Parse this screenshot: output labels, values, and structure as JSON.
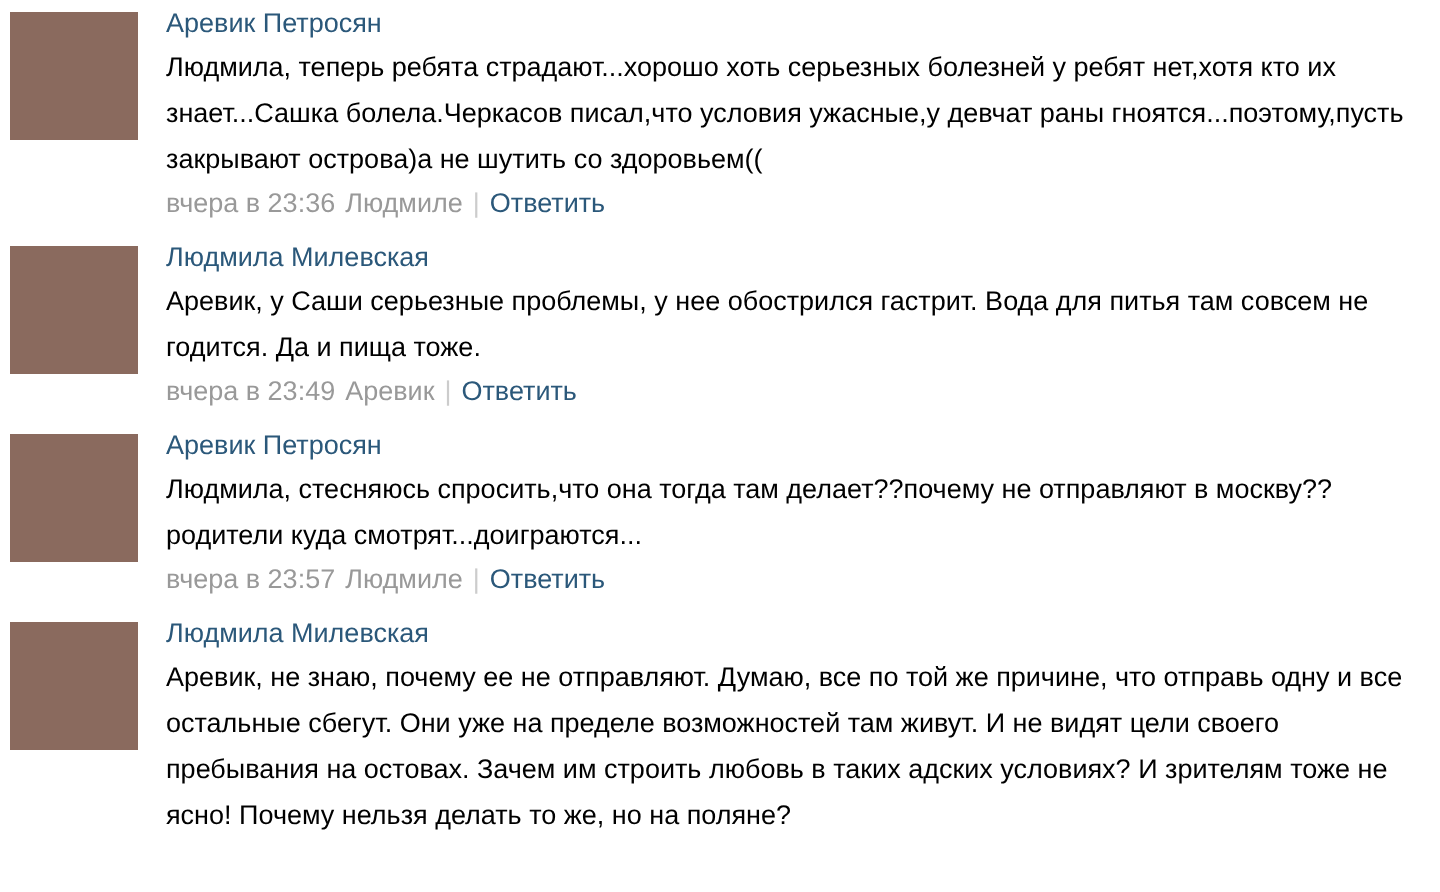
{
  "comments": [
    {
      "author": "Аревик Петросян",
      "text": "Людмила, теперь ребята страдают...хорошо хоть серьезных болезней у ребят нет,хотя кто их знает...Сашка болела.Черкасов писал,что условия ужасные,у девчат раны гноятся...поэтому,пусть закрывают острова)а не шутить со здоровьем((",
      "meta": {
        "date": "вчера в 23:36",
        "reply_to": "Людмиле",
        "separator": "|",
        "action": "Ответить"
      }
    },
    {
      "author": "Людмила Милевская",
      "text": "Аревик, у Саши серьезные проблемы, у нее обострился гастрит. Вода для питья там совсем не годится. Да и пища тоже.",
      "meta": {
        "date": "вчера в 23:49",
        "reply_to": "Аревик",
        "separator": "|",
        "action": "Ответить"
      }
    },
    {
      "author": "Аревик Петросян",
      "text": "Людмила, стесняюсь спросить,что она тогда там делает??почему не отправляют в москву?? родители куда смотрят...доиграются...",
      "meta": {
        "date": "вчера в 23:57",
        "reply_to": "Людмиле",
        "separator": "|",
        "action": "Ответить"
      }
    },
    {
      "author": "Людмила Милевская",
      "text": "Аревик, не знаю, почему ее не отправляют. Думаю, все по той же причине, что отправь одну и все остальные сбегут. Они уже на пределе возможностей там живут. И не видят цели своего пребывания на остовах. Зачем им строить любовь в таких адских условиях? И зрителям тоже не ясно! Почему нельзя делать то же, но на поляне?"
    }
  ]
}
